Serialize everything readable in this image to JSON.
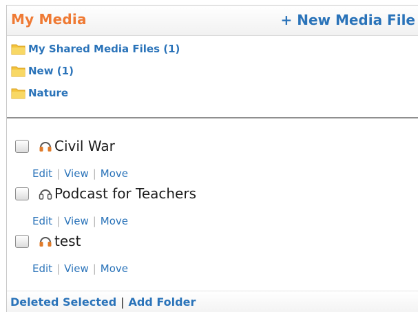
{
  "header": {
    "title": "My Media",
    "new_file_label": "+ New Media File"
  },
  "folders": [
    {
      "label": "My Shared Media Files (1)",
      "icon": "folder-icon"
    },
    {
      "label": "New (1)",
      "icon": "folder-icon"
    },
    {
      "label": "Nature",
      "icon": "folder-icon"
    }
  ],
  "files": [
    {
      "name": "Civil War",
      "icon": "headphones-icon",
      "icon_color": "#e07b2a",
      "checked": false
    },
    {
      "name": "Podcast for Teachers",
      "icon": "headphones-icon",
      "icon_color": "#555555",
      "checked": false
    },
    {
      "name": "test",
      "icon": "headphones-icon",
      "icon_color": "#e07b2a",
      "checked": false
    }
  ],
  "file_actions": {
    "edit": "Edit",
    "view": "View",
    "move": "Move",
    "separator": "|"
  },
  "footer": {
    "delete_label": "Deleted Selected",
    "separator": "|",
    "add_folder_label": "Add Folder"
  },
  "colors": {
    "title": "#ef7a34",
    "link": "#2a73b9",
    "folder": "#f3c640"
  }
}
